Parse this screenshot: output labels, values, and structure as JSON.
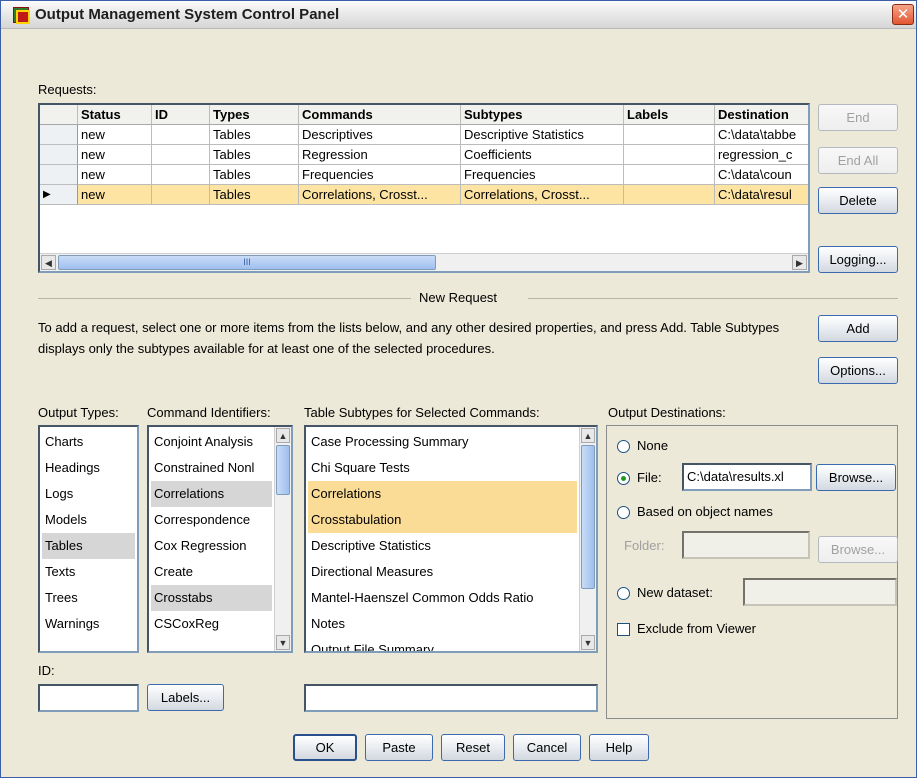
{
  "window": {
    "title": "Output Management System Control Panel",
    "close_glyph": "✕"
  },
  "requests": {
    "label": "Requests:",
    "columns": [
      "Status",
      "ID",
      "Types",
      "Commands",
      "Subtypes",
      "Labels",
      "Destination"
    ],
    "rows": [
      [
        "new",
        "",
        "Tables",
        "Descriptives",
        "Descriptive Statistics",
        "",
        "C:\\data\\tabbe"
      ],
      [
        "new",
        "",
        "Tables",
        "Regression",
        "Coefficients",
        "",
        "regression_c"
      ],
      [
        "new",
        "",
        "Tables",
        "Frequencies",
        "Frequencies",
        "",
        "C:\\data\\coun"
      ],
      [
        "new",
        "",
        "Tables",
        "Correlations, Crosst...",
        "Correlations, Crosst...",
        "",
        "C:\\data\\resul"
      ]
    ],
    "selected_row_marker": "▶",
    "scroll_grip": "III",
    "scroll_left": "◀",
    "scroll_right": "▶"
  },
  "side_buttons": {
    "end": "End",
    "end_all": "End All",
    "delete": "Delete",
    "logging": "Logging..."
  },
  "new_request": {
    "heading": "New Request",
    "help_text": "To add a request, select one or more items from the lists below, and any other desired properties, and press Add. Table Subtypes displays only the subtypes available for at least one of the selected procedures.",
    "add": "Add",
    "options": "Options..."
  },
  "output_types": {
    "label": "Output Types:",
    "items": [
      "Charts",
      "Headings",
      "Logs",
      "Models",
      "Tables",
      "Texts",
      "Trees",
      "Warnings"
    ],
    "selected": "Tables"
  },
  "command_identifiers": {
    "label": "Command Identifiers:",
    "items": [
      "Conjoint Analysis",
      "Constrained Nonl",
      "Correlations",
      "Correspondence",
      "Cox Regression",
      "Create",
      "Crosstabs",
      "CSCoxReg"
    ],
    "selected": [
      "Correlations",
      "Crosstabs"
    ]
  },
  "table_subtypes": {
    "label": "Table Subtypes for Selected Commands:",
    "items": [
      "Case Processing Summary",
      "Chi Square Tests",
      "Correlations",
      "Crosstabulation",
      "Descriptive Statistics",
      "Directional Measures",
      "Mantel-Haenszel Common Odds Ratio",
      "Notes",
      "Output File Summary"
    ],
    "selected": [
      "Correlations",
      "Crosstabulation"
    ]
  },
  "destinations": {
    "label": "Output Destinations:",
    "none": "None",
    "file": "File:",
    "file_value": "C:\\data\\results.xl",
    "browse": "Browse...",
    "based": "Based on object names",
    "folder": "Folder:",
    "browse2": "Browse...",
    "new_dataset": "New dataset:",
    "exclude": "Exclude from Viewer",
    "selected": "file"
  },
  "id_field": {
    "label": "ID:",
    "value": ""
  },
  "labels_button": "Labels...",
  "bottom_buttons": {
    "ok": "OK",
    "paste": "Paste",
    "reset": "Reset",
    "cancel": "Cancel",
    "help": "Help"
  }
}
